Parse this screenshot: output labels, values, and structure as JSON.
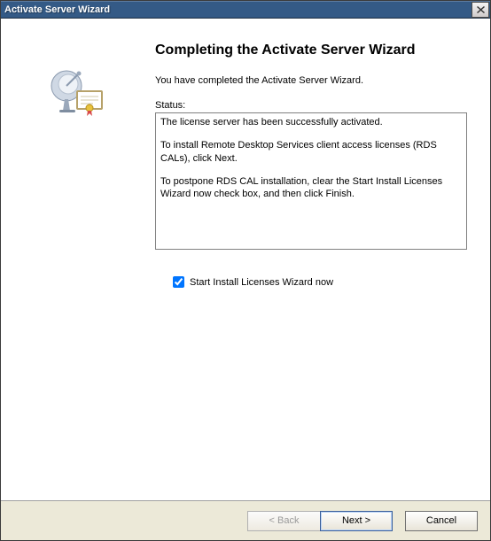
{
  "window": {
    "title": "Activate Server Wizard"
  },
  "header": {
    "title": "Completing the Activate Server Wizard",
    "intro": "You have completed the Activate Server Wizard."
  },
  "status": {
    "label": "Status:",
    "line1": "The license server has been successfully activated.",
    "line2": "To install Remote Desktop Services client access licenses (RDS CALs), click Next.",
    "line3": "To postpone RDS CAL installation, clear the Start Install Licenses Wizard now check box, and then click Finish."
  },
  "checkbox": {
    "label": "Start Install Licenses Wizard now",
    "checked": true
  },
  "buttons": {
    "back": "< Back",
    "next": "Next >",
    "cancel": "Cancel"
  }
}
